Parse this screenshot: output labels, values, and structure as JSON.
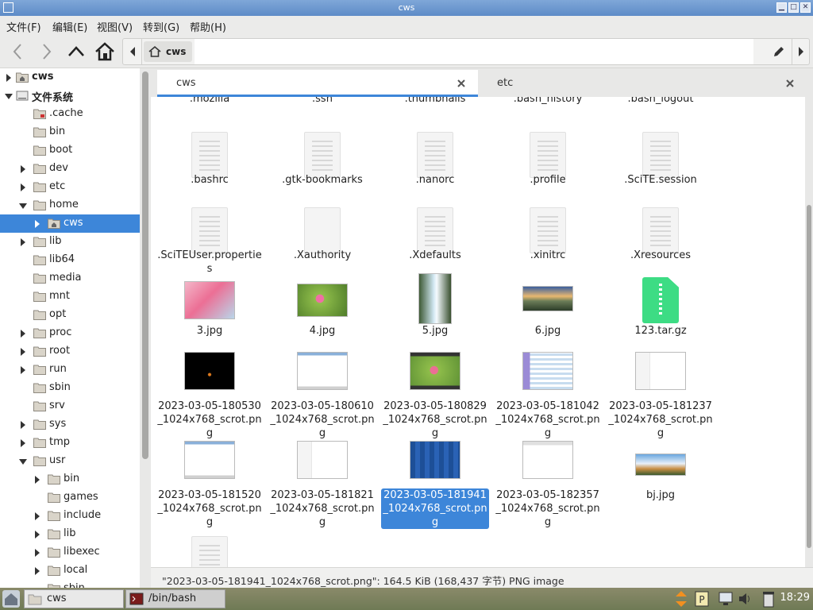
{
  "window": {
    "title": "cws"
  },
  "menu": [
    "文件(F)",
    "编辑(E)",
    "视图(V)",
    "转到(G)",
    "帮助(H)"
  ],
  "path": {
    "crumb": "cws"
  },
  "sidebar": {
    "items": [
      {
        "label": "cws",
        "depth": 0,
        "expander": "collapsed",
        "icon": "home-folder",
        "bold": true
      },
      {
        "label": "文件系统",
        "depth": 0,
        "expander": "expanded",
        "icon": "drive",
        "bold": true
      },
      {
        "label": ".cache",
        "depth": 1,
        "expander": "none",
        "icon": "folder-locked"
      },
      {
        "label": "bin",
        "depth": 1,
        "expander": "none",
        "icon": "folder"
      },
      {
        "label": "boot",
        "depth": 1,
        "expander": "none",
        "icon": "folder"
      },
      {
        "label": "dev",
        "depth": 1,
        "expander": "collapsed",
        "icon": "folder"
      },
      {
        "label": "etc",
        "depth": 1,
        "expander": "collapsed",
        "icon": "folder"
      },
      {
        "label": "home",
        "depth": 1,
        "expander": "expanded",
        "icon": "folder"
      },
      {
        "label": "cws",
        "depth": 2,
        "expander": "collapsed",
        "icon": "home-folder",
        "selected": true
      },
      {
        "label": "lib",
        "depth": 1,
        "expander": "collapsed",
        "icon": "folder"
      },
      {
        "label": "lib64",
        "depth": 1,
        "expander": "none",
        "icon": "folder"
      },
      {
        "label": "media",
        "depth": 1,
        "expander": "none",
        "icon": "folder"
      },
      {
        "label": "mnt",
        "depth": 1,
        "expander": "none",
        "icon": "folder"
      },
      {
        "label": "opt",
        "depth": 1,
        "expander": "none",
        "icon": "folder"
      },
      {
        "label": "proc",
        "depth": 1,
        "expander": "collapsed",
        "icon": "folder"
      },
      {
        "label": "root",
        "depth": 1,
        "expander": "collapsed",
        "icon": "folder"
      },
      {
        "label": "run",
        "depth": 1,
        "expander": "collapsed",
        "icon": "folder"
      },
      {
        "label": "sbin",
        "depth": 1,
        "expander": "none",
        "icon": "folder"
      },
      {
        "label": "srv",
        "depth": 1,
        "expander": "none",
        "icon": "folder"
      },
      {
        "label": "sys",
        "depth": 1,
        "expander": "collapsed",
        "icon": "folder"
      },
      {
        "label": "tmp",
        "depth": 1,
        "expander": "collapsed",
        "icon": "folder"
      },
      {
        "label": "usr",
        "depth": 1,
        "expander": "expanded",
        "icon": "folder"
      },
      {
        "label": "bin",
        "depth": 2,
        "expander": "collapsed",
        "icon": "folder"
      },
      {
        "label": "games",
        "depth": 2,
        "expander": "none",
        "icon": "folder"
      },
      {
        "label": "include",
        "depth": 2,
        "expander": "collapsed",
        "icon": "folder"
      },
      {
        "label": "lib",
        "depth": 2,
        "expander": "collapsed",
        "icon": "folder"
      },
      {
        "label": "libexec",
        "depth": 2,
        "expander": "collapsed",
        "icon": "folder"
      },
      {
        "label": "local",
        "depth": 2,
        "expander": "collapsed",
        "icon": "folder"
      },
      {
        "label": "sbin",
        "depth": 2,
        "expander": "none",
        "icon": "folder"
      }
    ]
  },
  "tabs": [
    {
      "label": "cws",
      "active": true
    },
    {
      "label": "etc",
      "active": false
    }
  ],
  "files": {
    "partial_top_row": [
      ".mozilla",
      ".ssh",
      ".thumbnails",
      ".bash_history",
      ".bash_logout"
    ],
    "rows": [
      [
        {
          "name": ".bashrc",
          "kind": "text"
        },
        {
          "name": ".gtk-bookmarks",
          "kind": "text"
        },
        {
          "name": ".nanorc",
          "kind": "text"
        },
        {
          "name": ".profile",
          "kind": "text"
        },
        {
          "name": ".SciTE.session",
          "kind": "text"
        }
      ],
      [
        {
          "name": ".SciTEUser.properties",
          "kind": "text"
        },
        {
          "name": ".Xauthority",
          "kind": "blank"
        },
        {
          "name": ".Xdefaults",
          "kind": "text"
        },
        {
          "name": ".xinitrc",
          "kind": "text"
        },
        {
          "name": ".Xresources",
          "kind": "text"
        }
      ],
      [
        {
          "name": "3.jpg",
          "kind": "photo",
          "theme": "pink-blossom"
        },
        {
          "name": "4.jpg",
          "kind": "photo",
          "theme": "flower-green"
        },
        {
          "name": "5.jpg",
          "kind": "photo",
          "theme": "waterfall"
        },
        {
          "name": "6.jpg",
          "kind": "photo",
          "theme": "sunset-landscape"
        },
        {
          "name": "123.tar.gz",
          "kind": "archive"
        }
      ],
      [
        {
          "name": "2023-03-05-180530_1024x768_scrot.png",
          "kind": "screenshot",
          "theme": "dark"
        },
        {
          "name": "2023-03-05-180610_1024x768_scrot.png",
          "kind": "screenshot",
          "theme": "white"
        },
        {
          "name": "2023-03-05-180829_1024x768_scrot.png",
          "kind": "screenshot",
          "theme": "flower"
        },
        {
          "name": "2023-03-05-181042_1024x768_scrot.png",
          "kind": "screenshot",
          "theme": "grid"
        },
        {
          "name": "2023-03-05-181237_1024x768_scrot.png",
          "kind": "screenshot",
          "theme": "filemanager"
        }
      ],
      [
        {
          "name": "2023-03-05-181520_1024x768_scrot.png",
          "kind": "screenshot",
          "theme": "white"
        },
        {
          "name": "2023-03-05-181821_1024x768_scrot.png",
          "kind": "screenshot",
          "theme": "filemanager"
        },
        {
          "name": "2023-03-05-181941_1024x768_scrot.png",
          "kind": "screenshot",
          "theme": "blue",
          "selected": true
        },
        {
          "name": "2023-03-05-182357_1024x768_scrot.png",
          "kind": "screenshot",
          "theme": "dialog"
        },
        {
          "name": "bj.jpg",
          "kind": "photo",
          "theme": "mountains"
        }
      ],
      [
        {
          "name": "",
          "kind": "text"
        }
      ]
    ]
  },
  "status": {
    "text": "\"2023-03-05-181941_1024x768_scrot.png\": 164.5 KiB (168,437 字节) PNG image"
  },
  "taskbar": {
    "tasks": [
      {
        "label": "cws",
        "icon": "folder-icon",
        "active": true
      },
      {
        "label": "/bin/bash",
        "icon": "terminal-icon",
        "active": false
      }
    ],
    "clock": "18:29"
  },
  "colors": {
    "accent": "#3d86d9",
    "titlebar": "#6a97cf",
    "folder": "#d9d4c9"
  }
}
